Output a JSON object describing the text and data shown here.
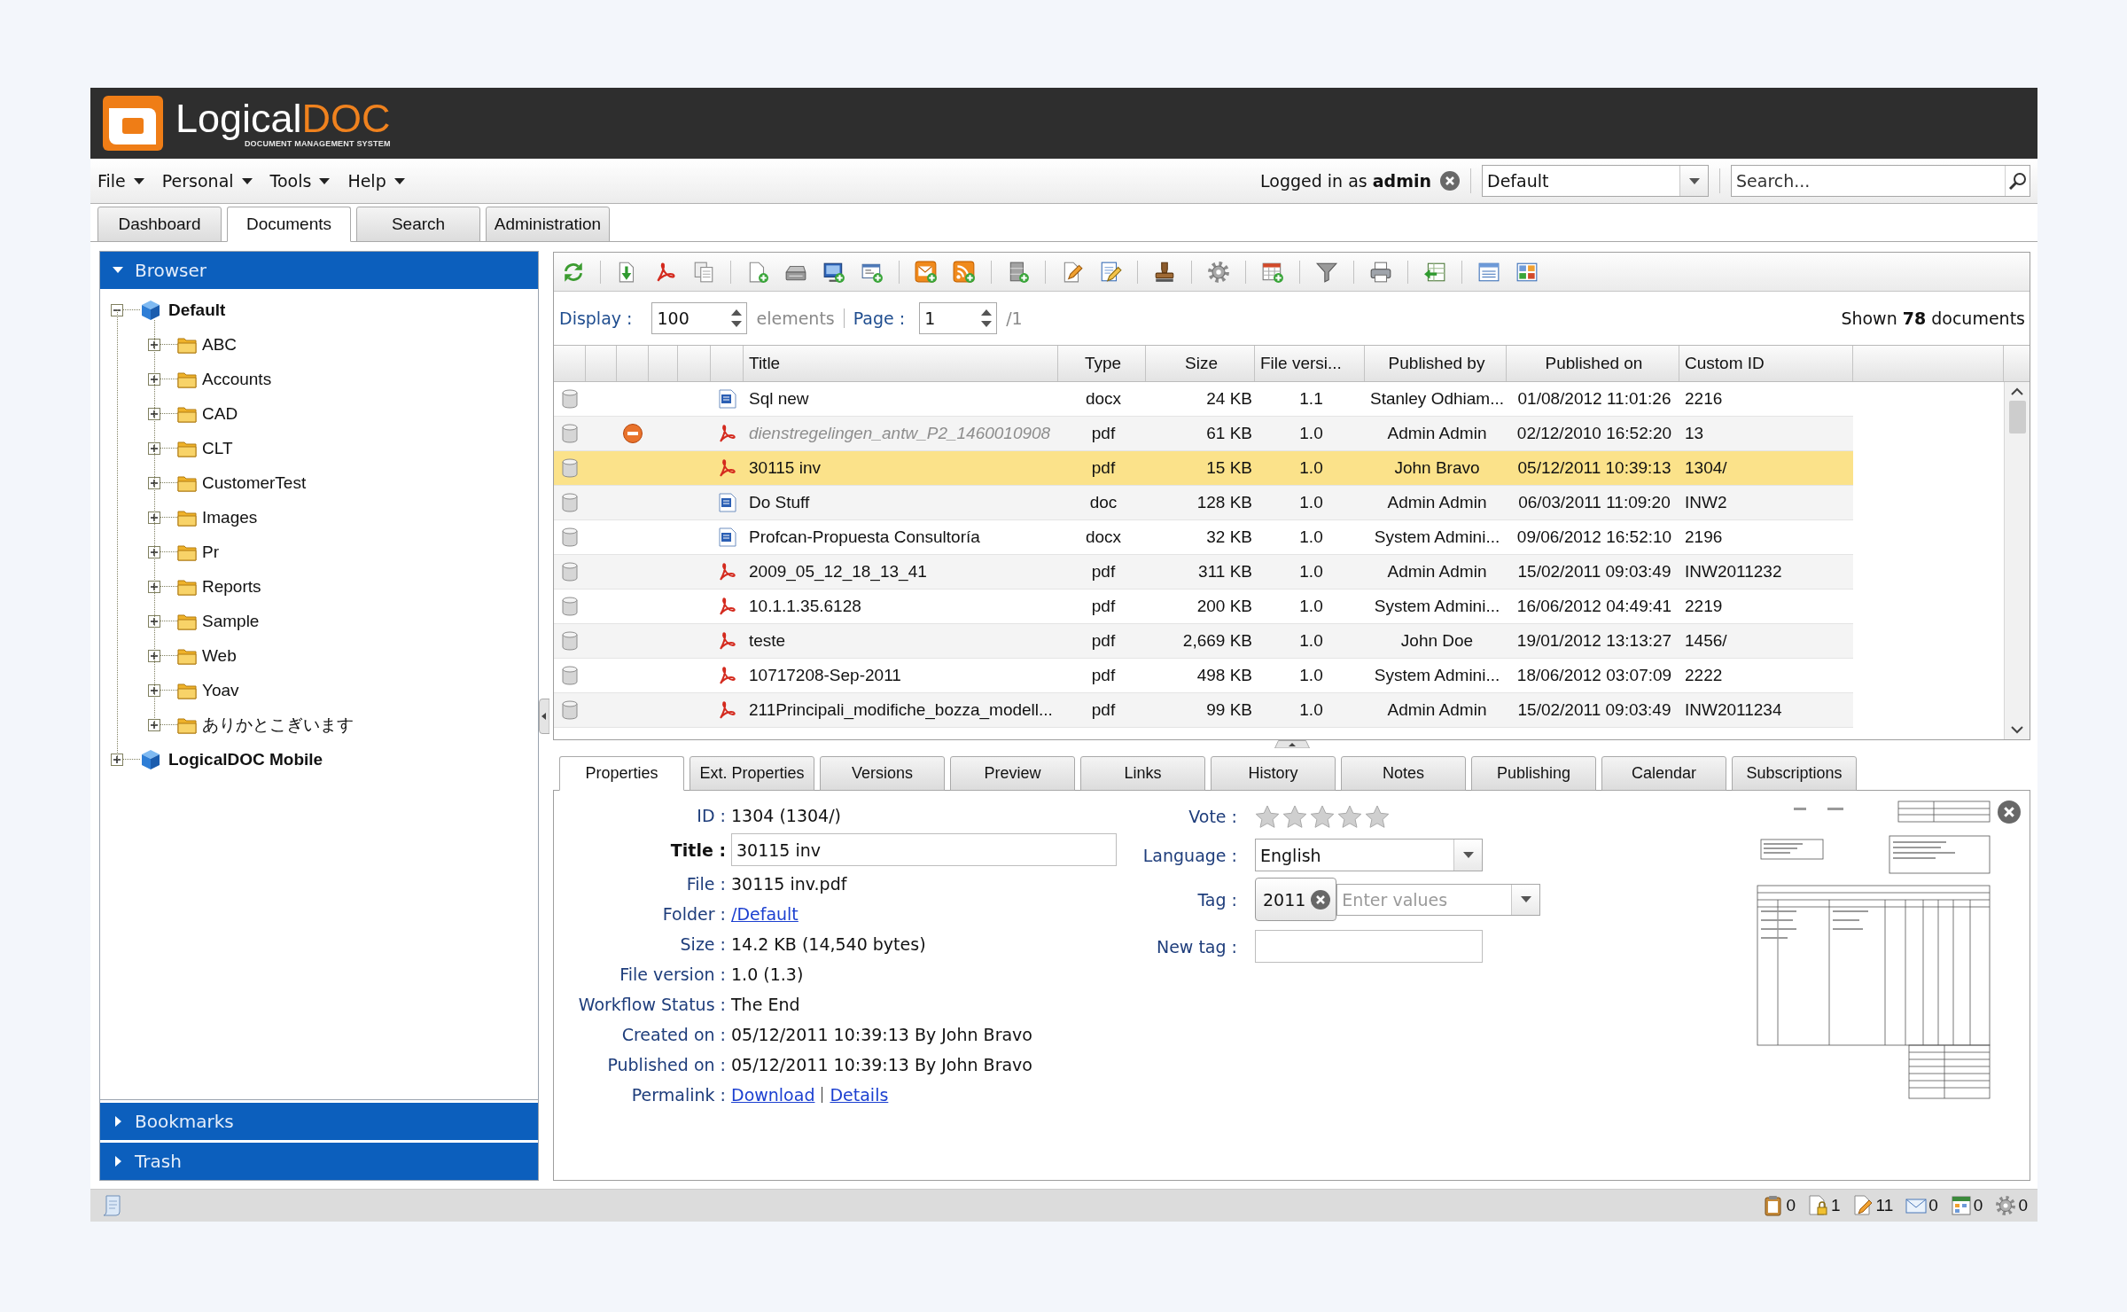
{
  "header": {
    "logo": {
      "name": "Logical",
      "accent": "DOC",
      "tagline": "DOCUMENT MANAGEMENT SYSTEM"
    }
  },
  "menu": [
    {
      "label": "File"
    },
    {
      "label": "Personal"
    },
    {
      "label": "Tools"
    },
    {
      "label": "Help"
    }
  ],
  "session": {
    "text": "Logged in as **admin**"
  },
  "workspace_select": {
    "value": "Default"
  },
  "search": {
    "placeholder": "Search..."
  },
  "tabs": [
    {
      "label": "Dashboard",
      "selected": false
    },
    {
      "label": "Documents",
      "selected": true
    },
    {
      "label": "Search",
      "selected": false
    },
    {
      "label": "Administration",
      "selected": false
    }
  ],
  "sidebar": {
    "sections": [
      {
        "label": "Browser",
        "expanded": true,
        "tree": [
          {
            "label": "Default",
            "kind": "workspace",
            "expanded": true,
            "children": [
              {
                "label": "ABC",
                "kind": "folder",
                "expanded": false
              },
              {
                "label": "Accounts",
                "kind": "folder",
                "expanded": false
              },
              {
                "label": "CAD",
                "kind": "folder",
                "expanded": false
              },
              {
                "label": "CLT",
                "kind": "folder",
                "expanded": false
              },
              {
                "label": "CustomerTest",
                "kind": "folder",
                "expanded": false
              },
              {
                "label": "Images",
                "kind": "folder",
                "expanded": false
              },
              {
                "label": "Pr",
                "kind": "folder",
                "expanded": false
              },
              {
                "label": "Reports",
                "kind": "folder",
                "expanded": false
              },
              {
                "label": "Sample",
                "kind": "folder",
                "expanded": false
              },
              {
                "label": "Web",
                "kind": "folder",
                "expanded": false
              },
              {
                "label": "Yoav",
                "kind": "folder",
                "expanded": false
              },
              {
                "label": "ありかとこぎいます",
                "kind": "folder",
                "expanded": false
              }
            ]
          },
          {
            "label": "LogicalDOC Mobile",
            "kind": "workspace",
            "expanded": false
          }
        ]
      },
      {
        "label": "Bookmarks",
        "expanded": false
      },
      {
        "label": "Trash",
        "expanded": false
      }
    ]
  },
  "pager": {
    "display_label": "Display :",
    "display_value": "100",
    "unit_label": "elements",
    "page_label": "Page :",
    "page_value": "1",
    "page_total": "/1",
    "summary": "Shown **78** documents"
  },
  "table": {
    "columns": [
      "Title",
      "Type",
      "Size",
      "File versi...",
      "Published by",
      "Published on",
      "Custom ID"
    ],
    "rows": [
      {
        "kind": "word",
        "stopped": false,
        "selected": false,
        "cells": [
          "Sql new",
          "docx",
          "24 KB",
          "1.1",
          "Stanley Odhiam...",
          "01/08/2012 11:01:26",
          "2216"
        ]
      },
      {
        "kind": "pdf",
        "stopped": true,
        "selected": false,
        "cells": [
          "dienstregelingen_antw_P2_1460010908",
          "pdf",
          "61 KB",
          "1.0",
          "Admin Admin",
          "02/12/2010 16:52:20",
          "13"
        ]
      },
      {
        "kind": "pdf",
        "stopped": false,
        "selected": true,
        "cells": [
          "30115 inv",
          "pdf",
          "15 KB",
          "1.0",
          "John Bravo",
          "05/12/2011 10:39:13",
          "1304/"
        ]
      },
      {
        "kind": "word",
        "stopped": false,
        "selected": false,
        "cells": [
          "Do Stuff",
          "doc",
          "128 KB",
          "1.0",
          "Admin Admin",
          "06/03/2011 11:09:20",
          "INW2"
        ]
      },
      {
        "kind": "word",
        "stopped": false,
        "selected": false,
        "cells": [
          "Profcan-Propuesta Consultoría",
          "docx",
          "32 KB",
          "1.0",
          "System Admini...",
          "09/06/2012 16:52:10",
          "2196"
        ]
      },
      {
        "kind": "pdf",
        "stopped": false,
        "selected": false,
        "cells": [
          "2009_05_12_18_13_41",
          "pdf",
          "311 KB",
          "1.0",
          "Admin Admin",
          "15/02/2011 09:03:49",
          "INW2011232"
        ]
      },
      {
        "kind": "pdf",
        "stopped": false,
        "selected": false,
        "cells": [
          "10.1.1.35.6128",
          "pdf",
          "200 KB",
          "1.0",
          "System Admini...",
          "16/06/2012 04:49:41",
          "2219"
        ]
      },
      {
        "kind": "pdf",
        "stopped": false,
        "selected": false,
        "cells": [
          "teste",
          "pdf",
          "2,669 KB",
          "1.0",
          "John Doe",
          "19/01/2012 13:13:27",
          "1456/"
        ]
      },
      {
        "kind": "pdf",
        "stopped": false,
        "selected": false,
        "cells": [
          "10717208-Sep-2011",
          "pdf",
          "498 KB",
          "1.0",
          "System Admini...",
          "18/06/2012 03:07:09",
          "2222"
        ]
      },
      {
        "kind": "pdf",
        "stopped": false,
        "selected": false,
        "cells": [
          "211Principali_modifiche_bozza_modell...",
          "pdf",
          "99 KB",
          "1.0",
          "Admin Admin",
          "15/02/2011 09:03:49",
          "INW2011234"
        ]
      }
    ]
  },
  "details": {
    "tabs": [
      {
        "label": "Properties",
        "selected": true
      },
      {
        "label": "Ext. Properties",
        "selected": false
      },
      {
        "label": "Versions",
        "selected": false
      },
      {
        "label": "Preview",
        "selected": false
      },
      {
        "label": "Links",
        "selected": false
      },
      {
        "label": "History",
        "selected": false
      },
      {
        "label": "Notes",
        "selected": false
      },
      {
        "label": "Publishing",
        "selected": false
      },
      {
        "label": "Calendar",
        "selected": false
      },
      {
        "label": "Subscriptions",
        "selected": false
      }
    ],
    "fields": [
      {
        "kind": "text",
        "label": "ID :",
        "value": "1304 (1304/)",
        "required": false
      },
      {
        "kind": "input",
        "label": "Title :",
        "value": "30115 inv",
        "required": true
      },
      {
        "kind": "text",
        "label": "File :",
        "value": "30115 inv.pdf",
        "required": false
      },
      {
        "kind": "link",
        "label": "Folder :",
        "value": "/Default",
        "required": false
      },
      {
        "kind": "text",
        "label": "Size :",
        "value": "14.2 KB (14,540 bytes)",
        "required": false
      },
      {
        "kind": "text",
        "label": "File version :",
        "value": "1.0 (1.3)",
        "required": false
      },
      {
        "kind": "text",
        "label": "Workflow Status :",
        "value": "The End",
        "required": false
      },
      {
        "kind": "text",
        "label": "Created on :",
        "value": "05/12/2011 10:39:13 By John Bravo",
        "required": false
      },
      {
        "kind": "text",
        "label": "Published on :",
        "value": "05/12/2011 10:39:13 By John Bravo",
        "required": false
      },
      {
        "kind": "links",
        "label": "Permalink :",
        "links": [
          "Download",
          "Details"
        ],
        "required": false
      }
    ],
    "vote": {
      "label": "Vote :",
      "stars": 0
    },
    "language": {
      "label": "Language :",
      "value": "English"
    },
    "tag": {
      "label": "Tag :",
      "tags": [
        "2011"
      ],
      "placeholder": "Enter values"
    },
    "new_tag": {
      "label": "New tag :"
    }
  },
  "status_bar": {
    "counters": [
      {
        "kind": "clipboard",
        "count": "0"
      },
      {
        "kind": "locked",
        "count": "1"
      },
      {
        "kind": "editing",
        "count": "11"
      },
      {
        "kind": "mail",
        "count": "0"
      },
      {
        "kind": "calendar",
        "count": "0"
      },
      {
        "kind": "gear",
        "count": "0"
      }
    ]
  }
}
